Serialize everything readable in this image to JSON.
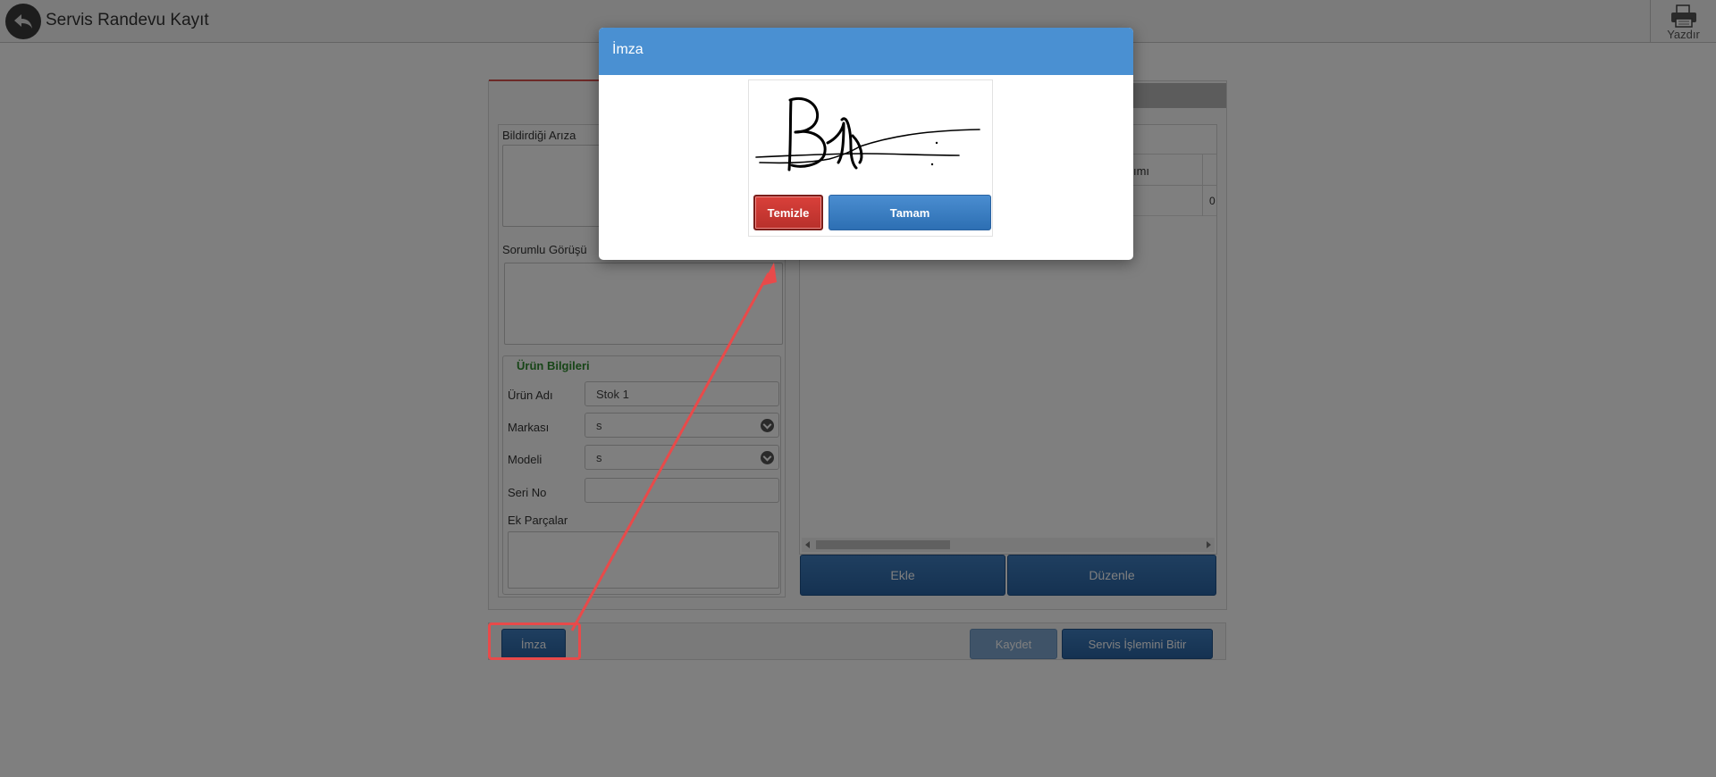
{
  "header": {
    "title": "Servis Randevu Kayıt",
    "print_label": "Yazdır"
  },
  "form": {
    "ariza_label": "Bildirdiği Arıza",
    "gorus_label": "Sorumlu Görüşü",
    "urun": {
      "legend": "Ürün Bilgileri",
      "urun_adi_label": "Ürün Adı",
      "urun_adi_value": "Stok 1",
      "marka_label": "Markası",
      "marka_value": "s",
      "model_label": "Modeli",
      "model_value": "s",
      "seri_label": "Seri No",
      "seri_value": "",
      "ek_label": "Ek Parçalar"
    },
    "grid": {
      "col_tanimi": "Tanımı",
      "cell_clip": "0"
    },
    "ekle_label": "Ekle",
    "duzenle_label": "Düzenle"
  },
  "bottom": {
    "imza_label": "İmza",
    "kaydet_label": "Kaydet",
    "bitir_label": "Servis İşlemini Bitir"
  },
  "modal": {
    "title": "İmza",
    "temizle_label": "Temizle",
    "tamam_label": "Tamam"
  },
  "colors": {
    "accent_blue": "#4a90d2",
    "danger_red": "#d9403a",
    "annotation_red": "#e84a4a",
    "legend_green": "#2e8b2e"
  }
}
